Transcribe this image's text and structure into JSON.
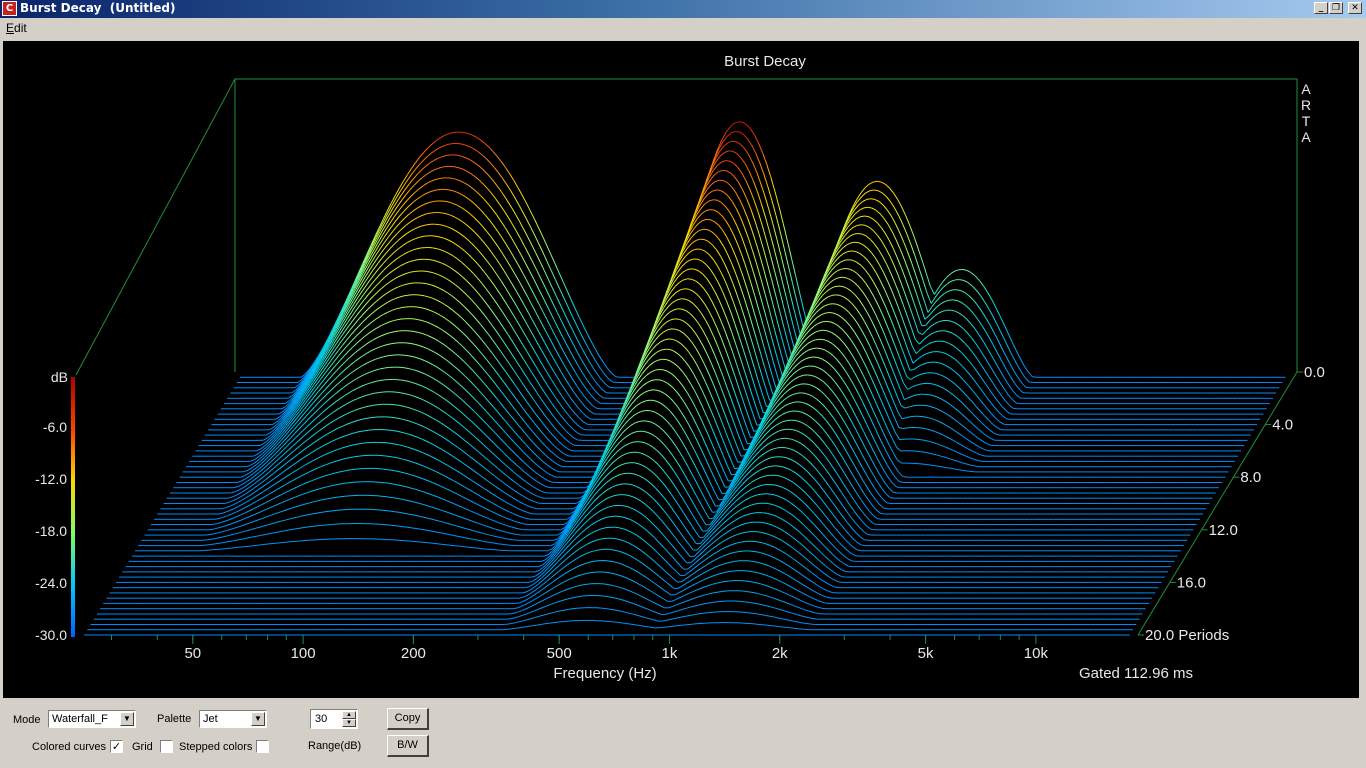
{
  "window": {
    "title": "Burst Decay  (Untitled)",
    "icon": "arta-app-icon",
    "buttons": [
      "minimize",
      "restore",
      "close"
    ]
  },
  "menu": {
    "items": [
      "Edit"
    ]
  },
  "controls": {
    "mode_label": "Mode",
    "mode_value": "Waterfall_F",
    "palette_label": "Palette",
    "palette_value": "Jet",
    "range_value": "30",
    "range_label": "Range(dB)",
    "copy_label": "Copy",
    "bw_label": "B/W",
    "colored_curves_label": "Colored curves",
    "colored_curves_checked": true,
    "grid_label": "Grid",
    "grid_checked": false,
    "stepped_colors_label": "Stepped colors",
    "stepped_colors_checked": false
  },
  "chart_data": {
    "type": "waterfall",
    "title": "Burst Decay",
    "watermark": "ARTA",
    "xlabel": "Frequency (Hz)",
    "x_scale": "log",
    "x_ticks": [
      "50",
      "100",
      "200",
      "500",
      "1k",
      "2k",
      "5k",
      "10k"
    ],
    "zlabel": "dB",
    "z_ticks": [
      "-6.0",
      "-12.0",
      "-18.0",
      "-24.0",
      "-30.0"
    ],
    "zlim": [
      -30,
      0
    ],
    "depth_ticks": [
      "0.0",
      "4.0",
      "8.0",
      "12.0",
      "16.0",
      "20.0 Periods"
    ],
    "depth_range": [
      0,
      20
    ],
    "annotation": "Gated 112.96 ms",
    "palette": "Jet",
    "colorbar_colors": [
      "#b00000",
      "#ff4000",
      "#ffd800",
      "#80ff60",
      "#00c8ff",
      "#0060ff"
    ],
    "bands": [
      {
        "f1": 37,
        "f2": 270,
        "level_db": -1,
        "decay_periods": 14
      },
      {
        "f1": 340,
        "f2": 1000,
        "level_db": 0,
        "decay_periods": 20
      },
      {
        "f1": 800,
        "f2": 2400,
        "level_db": -7,
        "decay_periods": 20
      },
      {
        "f1": 1500,
        "f2": 3700,
        "level_db": -17,
        "decay_periods": 8
      }
    ]
  }
}
